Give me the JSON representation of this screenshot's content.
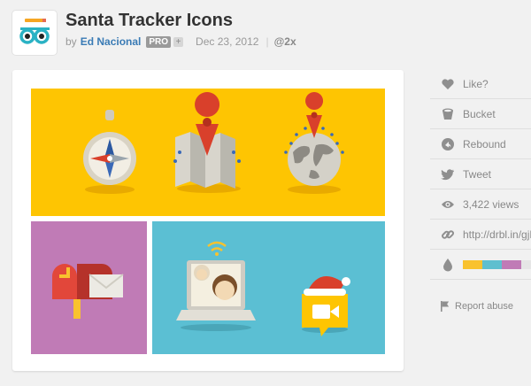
{
  "shot": {
    "title": "Santa Tracker Icons",
    "by_label": "by",
    "author": "Ed Nacional",
    "pro_badge": "PRO",
    "plus_badge": "+",
    "date": "Dec 23, 2012",
    "separator": "|",
    "resolution": "@2x"
  },
  "sidebar": {
    "like": "Like?",
    "bucket": "Bucket",
    "rebound": "Rebound",
    "tweet": "Tweet",
    "views": "3,422 views",
    "link": "http://drbl.in/gjD",
    "report": "Report abuse"
  },
  "palette": [
    "#f9c22e",
    "#5fbfcf",
    "#c07bb6",
    "#e6e6e6",
    "#e9e9e9"
  ],
  "icons": {
    "avatar": "glasses-icon",
    "like": "heart-icon",
    "bucket": "bucket-icon",
    "rebound": "rebound-icon",
    "tweet": "twitter-bird-icon",
    "views": "eye-icon",
    "link": "link-icon",
    "palette": "droplet-icon",
    "report": "flag-icon"
  },
  "colors": {
    "panel_yellow": "#fec502",
    "panel_purple": "#c07bb6",
    "panel_teal": "#5bbfd3",
    "author_link": "#3a7bb5"
  }
}
